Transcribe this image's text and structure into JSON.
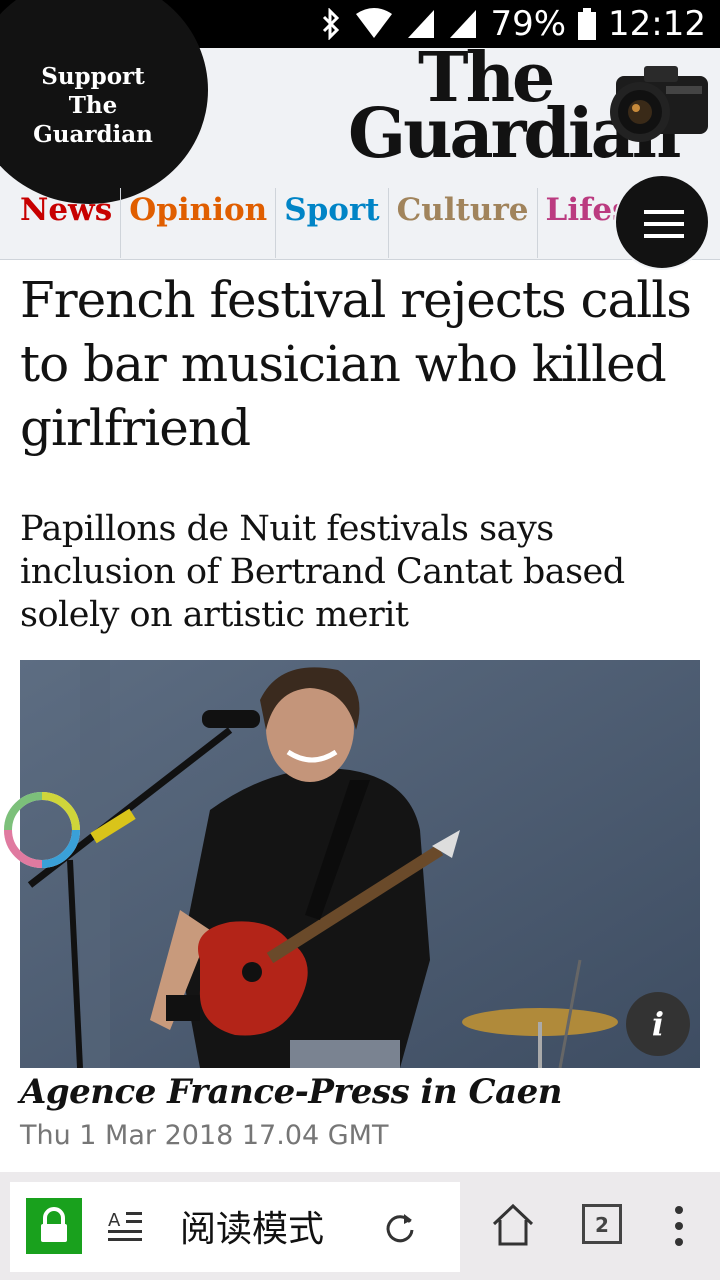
{
  "status_bar": {
    "battery": "79%",
    "time": "12:12",
    "icons": [
      "notification-flag-icon",
      "bluetooth-icon",
      "wifi-icon",
      "signal-icon",
      "signal-icon-2",
      "battery-icon"
    ]
  },
  "header": {
    "support_label": "Support The Guardian",
    "logo_line1": "The",
    "logo_line2": "Guardian",
    "nav": [
      {
        "label": "News",
        "color": "#c70000"
      },
      {
        "label": "Opinion",
        "color": "#e05e00"
      },
      {
        "label": "Sport",
        "color": "#0084c6"
      },
      {
        "label": "Culture",
        "color": "#a1845c"
      },
      {
        "label": "Lifestyle",
        "color": "#bb3b80"
      }
    ],
    "menu_icon": "hamburger-menu-icon"
  },
  "article": {
    "headline": "French festival rejects calls to bar musician who killed girlfriend",
    "standfirst": "Papillons de Nuit festivals says inclusion of Bertrand Cantat based solely on artistic merit",
    "image_info_label": "i",
    "byline": "Agence France-Press in Caen",
    "date": "Thu 1 Mar 2018 17.04 GMT"
  },
  "browser_bar": {
    "reader_mode_label": "阅读模式",
    "tab_count": "2",
    "icons": [
      "lock-icon",
      "reader-mode-icon",
      "reload-icon",
      "home-icon",
      "tabs-icon",
      "more-icon"
    ],
    "lock_color": "#19a11d"
  }
}
